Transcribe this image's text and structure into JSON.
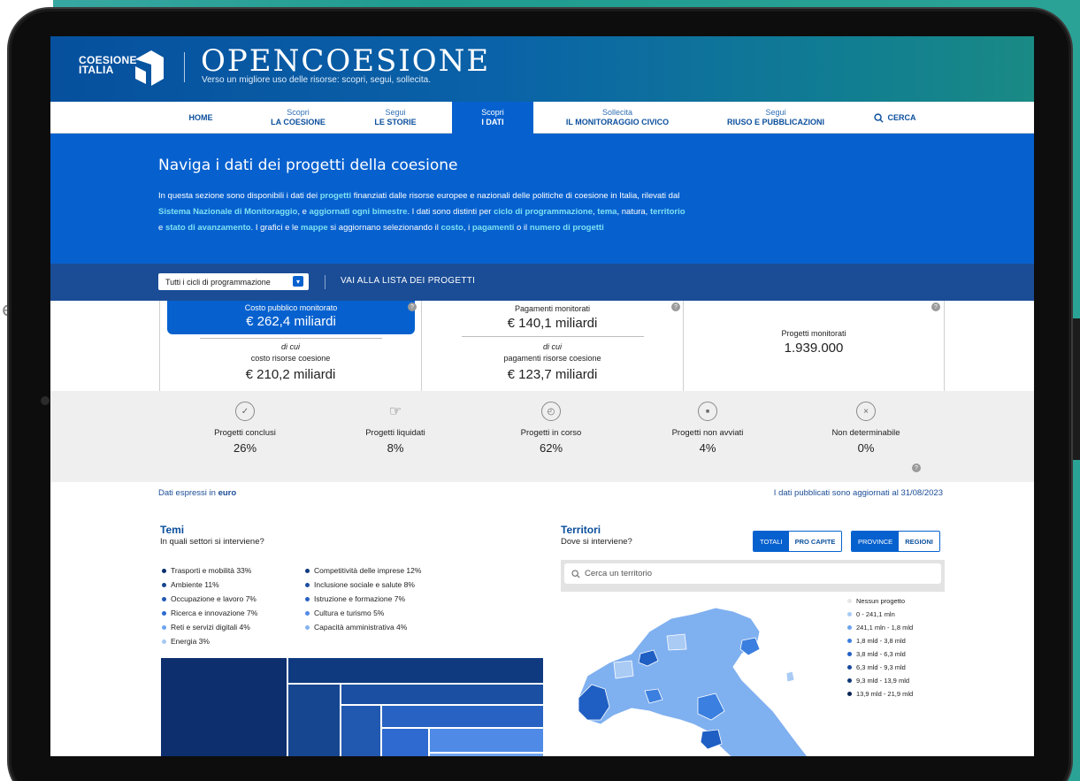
{
  "background": {
    "left_text": "e:"
  },
  "brand": {
    "logo_line1": "COESIONE",
    "logo_line2": "ITALIA",
    "title": "OPENCOESIONE",
    "subtitle": "Verso un migliore uso delle risorse: scopri, segui, sollecita."
  },
  "nav": {
    "items": [
      {
        "top": "",
        "main": "HOME"
      },
      {
        "top": "Scopri",
        "main": "LA COESIONE"
      },
      {
        "top": "Segui",
        "main": "LE STORIE"
      },
      {
        "top": "Scopri",
        "main": "I DATI"
      },
      {
        "top": "Sollecita",
        "main": "IL MONITORAGGIO CIVICO"
      },
      {
        "top": "Segui",
        "main": "RIUSO E PUBBLICAZIONI"
      }
    ],
    "search_label": "CERCA"
  },
  "hero": {
    "title": "Naviga i dati dei progetti della coesione",
    "t1": "In questa sezione sono disponibili i dati dei ",
    "h1": "progetti",
    "t2": " finanziati dalle risorse europee e nazionali delle politiche di coesione in Italia, rilevati dal ",
    "h2": "Sistema Nazionale di Monitoraggio",
    "t3": ", e ",
    "h3": "aggiornati ogni bimestre",
    "t4": ". I dati sono distinti per ",
    "h4": "ciclo di programmazione",
    "t5": ", ",
    "h5": "tema",
    "t6": ", natura, ",
    "h6": "territorio",
    "t7": " e ",
    "h7": "stato di avanzamento",
    "t8": ". I grafici e le ",
    "h8": "mappe",
    "t9": " si aggiornano selezionando il ",
    "h9": "costo",
    "t10": ", i ",
    "h10": "pagamenti",
    "t11": " o il ",
    "h11": "numero di progetti"
  },
  "filter": {
    "select_value": "Tutti i cicli di programmazione",
    "link": "VAI ALLA LISTA DEI PROGETTI"
  },
  "stats": {
    "costo_label": "Costo pubblico monitorato",
    "costo_value": "€ 262,4 miliardi",
    "costo_dicui": "di cui",
    "costo_sub_label": "costo risorse coesione",
    "costo_sub_value": "€ 210,2 miliardi",
    "pag_label": "Pagamenti monitorati",
    "pag_value": "€ 140,1 miliardi",
    "pag_dicui": "di cui",
    "pag_sub_label": "pagamenti risorse coesione",
    "pag_sub_value": "€ 123,7 miliardi",
    "prog_label": "Progetti monitorati",
    "prog_value": "1.939.000",
    "help": "?"
  },
  "statuses": [
    {
      "label": "Progetti conclusi",
      "pct": "26%",
      "icon": "✓"
    },
    {
      "label": "Progetti liquidati",
      "pct": "8%",
      "icon": "☞"
    },
    {
      "label": "Progetti in corso",
      "pct": "62%",
      "icon": "◴"
    },
    {
      "label": "Progetti non avviati",
      "pct": "4%",
      "icon": "■"
    },
    {
      "label": "Non determinabile",
      "pct": "0%",
      "icon": "×"
    }
  ],
  "info": {
    "left_text": "Dati espressi in ",
    "left_bold": "euro",
    "right_text": "I dati pubblicati sono aggiornati al 31/08/2023"
  },
  "temi": {
    "title": "Temi",
    "subtitle": "In quali settori si interviene?",
    "legend_left": [
      {
        "label": "Trasporti e mobilità 33%",
        "color": "#0d2f6e"
      },
      {
        "label": "Ambiente 11%",
        "color": "#16468f"
      },
      {
        "label": "Occupazione e lavoro 7%",
        "color": "#2259b0"
      },
      {
        "label": "Ricerca e innovazione 7%",
        "color": "#2e6ad0"
      },
      {
        "label": "Reti e servizi digitali 4%",
        "color": "#6ea4ee"
      },
      {
        "label": "Energia 3%",
        "color": "#a8c9f4"
      }
    ],
    "legend_right": [
      {
        "label": "Competitività delle imprese 12%",
        "color": "#0f3a80"
      },
      {
        "label": "Inclusione sociale e salute 8%",
        "color": "#1b4fa2"
      },
      {
        "label": "Istruzione e formazione 7%",
        "color": "#2862c2"
      },
      {
        "label": "Cultura e turismo 5%",
        "color": "#4f8ae6"
      },
      {
        "label": "Capacità amministrativa 4%",
        "color": "#86b4f0"
      }
    ]
  },
  "territori": {
    "title": "Territori",
    "subtitle": "Dove si interviene?",
    "toggle1": [
      "TOTALI",
      "PRO CAPITE"
    ],
    "toggle2": [
      "PROVINCE",
      "REGIONI"
    ],
    "search_placeholder": "Cerca un territorio",
    "legend": [
      {
        "label": "Nessun progetto",
        "color": "#e6e6e6"
      },
      {
        "label": "0 - 241,1 mln",
        "color": "#a9cbf4"
      },
      {
        "label": "241,1 mln - 1,8 mld",
        "color": "#6ea4ee"
      },
      {
        "label": "1,8 mld - 3,8 mld",
        "color": "#3b7fe0"
      },
      {
        "label": "3,8 mld - 6,3 mld",
        "color": "#1f5fc4"
      },
      {
        "label": "6,3 mld - 9,3 mld",
        "color": "#174a9e"
      },
      {
        "label": "9,3 mld - 13,9 mld",
        "color": "#103779"
      },
      {
        "label": "13,9 mld - 21,9 mld",
        "color": "#0a2556"
      }
    ]
  },
  "colors": {
    "brand_blue": "#0661cf",
    "dark_blue": "#1b4d96",
    "link": "#7ee0f2"
  }
}
